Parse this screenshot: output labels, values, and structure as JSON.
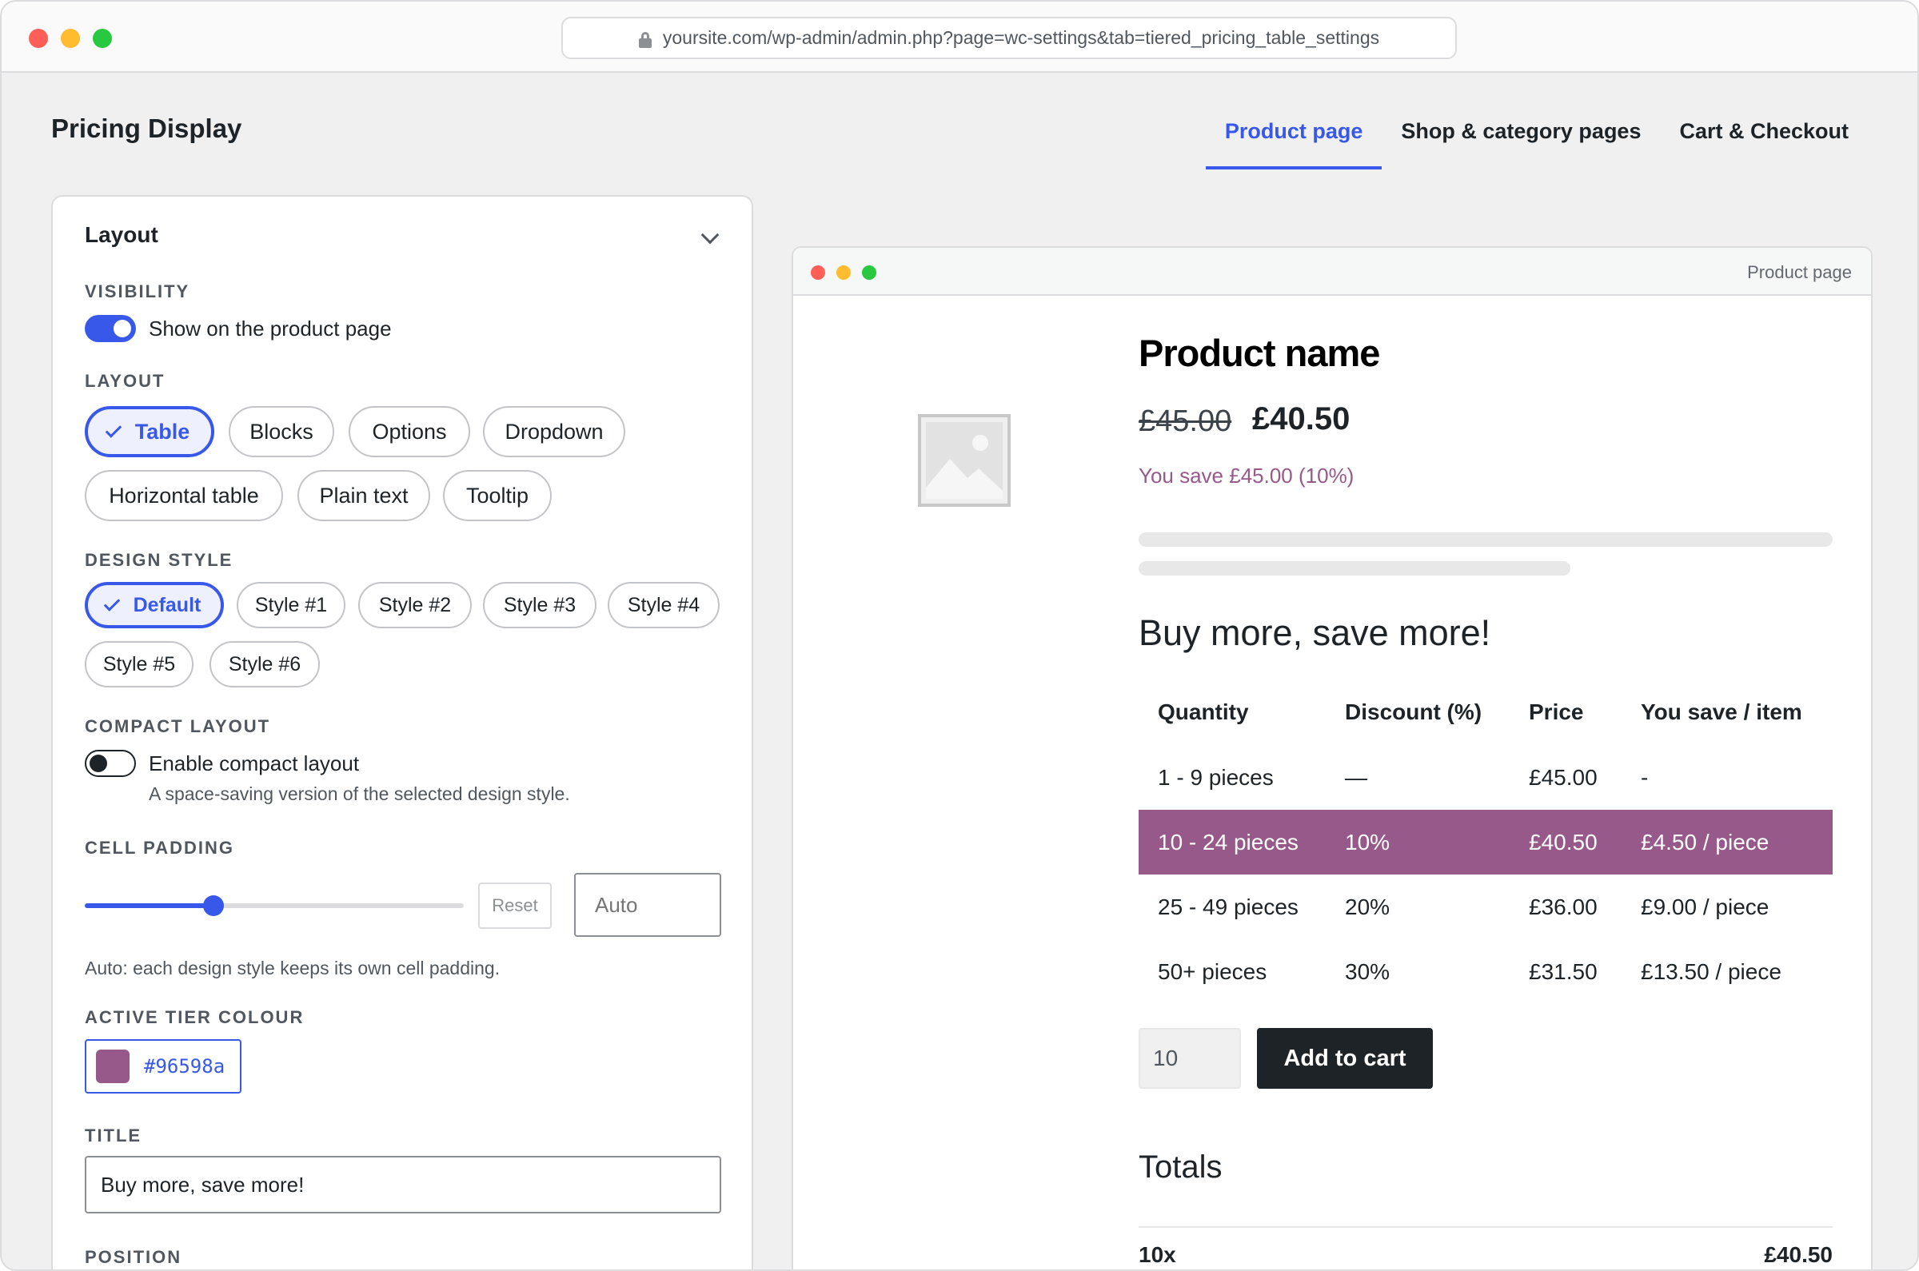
{
  "browser": {
    "url": "yoursite.com/wp-admin/admin.php?page=wc-settings&tab=tiered_pricing_table_settings"
  },
  "page": {
    "title": "Pricing Display"
  },
  "tabs": [
    {
      "label": "Product page",
      "active": true
    },
    {
      "label": "Shop & category pages",
      "active": false
    },
    {
      "label": "Cart & Checkout",
      "active": false
    }
  ],
  "panel": {
    "title": "Layout",
    "visibility": {
      "label": "VISIBILITY",
      "toggle_label": "Show on the product page",
      "enabled": true
    },
    "layout": {
      "label": "LAYOUT",
      "options": [
        "Table",
        "Blocks",
        "Options",
        "Dropdown",
        "Horizontal table",
        "Plain text",
        "Tooltip"
      ],
      "selected": "Table"
    },
    "design_style": {
      "label": "DESIGN STYLE",
      "options": [
        "Default",
        "Style #1",
        "Style #2",
        "Style #3",
        "Style #4",
        "Style #5",
        "Style #6"
      ],
      "selected": "Default"
    },
    "compact_layout": {
      "label": "COMPACT LAYOUT",
      "toggle_label": "Enable compact layout",
      "help": "A space-saving version of the selected design style.",
      "enabled": false
    },
    "cell_padding": {
      "label": "CELL PADDING",
      "slider_value_fraction": 0.34,
      "reset_label": "Reset",
      "value_placeholder": "Auto",
      "help": "Auto: each design style keeps its own cell padding."
    },
    "active_tier_colour": {
      "label": "ACTIVE TIER COLOUR",
      "value": "#96598a"
    },
    "title_field": {
      "label": "TITLE",
      "value": "Buy more, save more!"
    },
    "position": {
      "label": "POSITION"
    }
  },
  "preview": {
    "window_title": "Product page",
    "product_name": "Product name",
    "old_price": "£45.00",
    "new_price": "£40.50",
    "you_save": "You save £45.00 (10%)",
    "heading": "Buy more, save more!",
    "table": {
      "headers": [
        "Quantity",
        "Discount (%)",
        "Price",
        "You save / item"
      ],
      "rows": [
        [
          "1 - 9 pieces",
          "—",
          "£45.00",
          "-"
        ],
        [
          "10 - 24 pieces",
          "10%",
          "£40.50",
          "£4.50 / piece"
        ],
        [
          "25 - 49 pieces",
          "20%",
          "£36.00",
          "£9.00 / piece"
        ],
        [
          "50+ pieces",
          "30%",
          "£31.50",
          "£13.50 / piece"
        ]
      ],
      "active_row": 1
    },
    "quantity_value": "10",
    "add_to_cart_label": "Add to cart",
    "totals_heading": "Totals",
    "totals_qty": "10x",
    "totals_amount": "£40.50"
  },
  "colors": {
    "accent": "#3858e9",
    "active_tier": "#96598a",
    "dot_red": "#ff5f57",
    "dot_yellow": "#febc2e",
    "dot_green": "#28c840"
  }
}
